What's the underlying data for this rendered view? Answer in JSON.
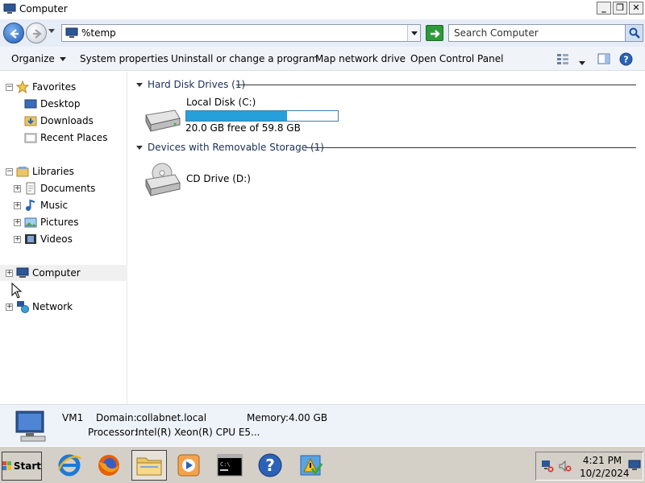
{
  "window": {
    "title": "Computer"
  },
  "address": {
    "value": "%temp",
    "search_placeholder": "Search Computer"
  },
  "toolbar": {
    "organize": "Organize",
    "system_properties": "System properties",
    "uninstall": "Uninstall or change a program",
    "map_network": "Map network drive",
    "control_panel": "Open Control Panel"
  },
  "sidebar": {
    "favorites": "Favorites",
    "desktop": "Desktop",
    "downloads": "Downloads",
    "recent_places": "Recent Places",
    "libraries": "Libraries",
    "documents": "Documents",
    "music": "Music",
    "pictures": "Pictures",
    "videos": "Videos",
    "computer": "Computer",
    "network": "Network"
  },
  "content": {
    "hdd_group": "Hard Disk Drives (1)",
    "removable_group": "Devices with Removable Storage (1)",
    "local_disk": {
      "name": "Local Disk (C:)",
      "free_text": "20.0 GB free of 59.8 GB",
      "used_fraction": 0.665
    },
    "cd_drive": {
      "name": "CD Drive (D:)"
    }
  },
  "details": {
    "name": "VM1",
    "domain_label": "Domain:",
    "domain_value": "collabnet.local",
    "memory_label": "Memory:",
    "memory_value": "4.00 GB",
    "processor_label": "Processor:",
    "processor_value": "Intel(R) Xeon(R) CPU E5..."
  },
  "taskbar": {
    "start": "Start",
    "time": "4:21 PM",
    "date": "10/2/2024"
  },
  "colors": {
    "accent": "#26a0da",
    "address_bg": "#e6edf7",
    "toolbar_bg": "#f0f4f9",
    "taskbar_bg": "#d4d0c8"
  }
}
